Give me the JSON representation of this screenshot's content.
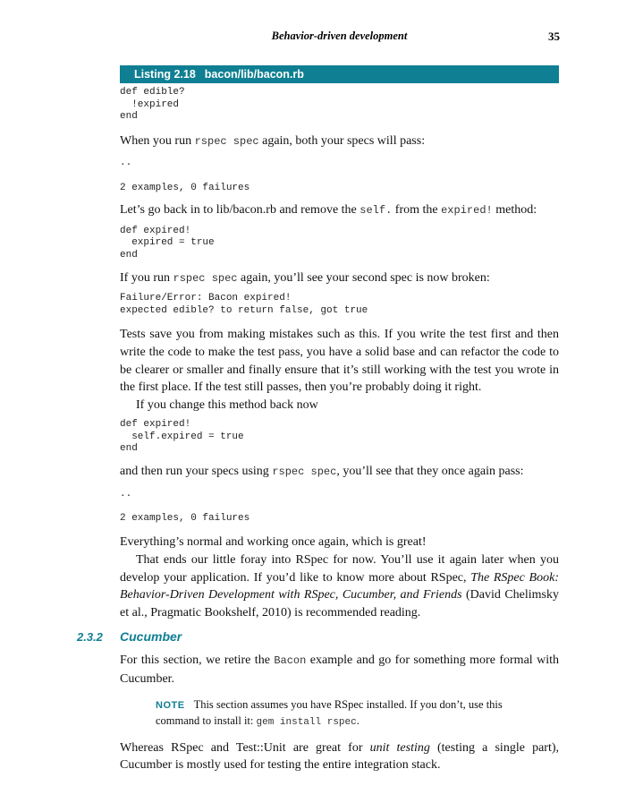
{
  "header": {
    "running_title": "Behavior-driven development",
    "page_number": "35"
  },
  "listing": {
    "label": "Listing 2.18",
    "filename": "bacon/lib/bacon.rb",
    "code": "def edible?\n  !expired\nend"
  },
  "p1": {
    "before": "When you run ",
    "code": "rspec spec",
    "after": " again, both your specs will pass:"
  },
  "output1": "..\n\n2 examples, 0 failures",
  "p2": {
    "before": "Let’s go back in to lib/bacon.rb and remove the ",
    "code1": "self.",
    "middle": " from the ",
    "code2": "expired!",
    "after": " method:"
  },
  "code2": "def expired!\n  expired = true\nend",
  "p3": {
    "before": "If you run ",
    "code": "rspec spec",
    "after": " again, you’ll see your second spec is now broken:"
  },
  "output2": "Failure/Error: Bacon expired!\nexpected edible? to return false, got true",
  "p4": "Tests save you from making mistakes such as this. If you write the test first and then write the code to make the test pass, you have a solid base and can refactor the code to be clearer or smaller and finally ensure that it’s still working with the test you wrote in the first place. If the test still passes, then you’re probably doing it right.",
  "p5": "If you change this method back now",
  "code3": "def expired!\n  self.expired = true\nend",
  "p6": {
    "before": "and then run your specs using ",
    "code": "rspec spec",
    "after": ", you’ll see that they once again pass:"
  },
  "output3": "..\n\n2 examples, 0 failures",
  "p7": "Everything’s normal and working once again, which is great!",
  "p8": {
    "before": "That ends our little foray into RSpec for now. You’ll use it again later when you develop your application. If you’d like to know more about RSpec, ",
    "book": "The RSpec Book: Behavior-Driven Development with RSpec, Cucumber, and Friends",
    "after": " (David Chelimsky et al., Pragmatic Bookshelf, 2010) is recommended reading."
  },
  "section": {
    "number": "2.3.2",
    "title": "Cucumber"
  },
  "p9": {
    "before": "For this section, we retire the ",
    "code": "Bacon",
    "after": " example and go for something more formal with Cucumber."
  },
  "note": {
    "label": "NOTE",
    "text": "This section assumes you have RSpec installed. If you don’t, use this command to install it: ",
    "code": "gem install rspec",
    "end": "."
  },
  "p10": {
    "before": "Whereas RSpec and Test::Unit are great for ",
    "em": "unit testing",
    "after": " (testing a single part), Cucumber is mostly used for testing the entire integration stack."
  },
  "colors": {
    "accent": "#0f7f93",
    "text": "#111111"
  }
}
